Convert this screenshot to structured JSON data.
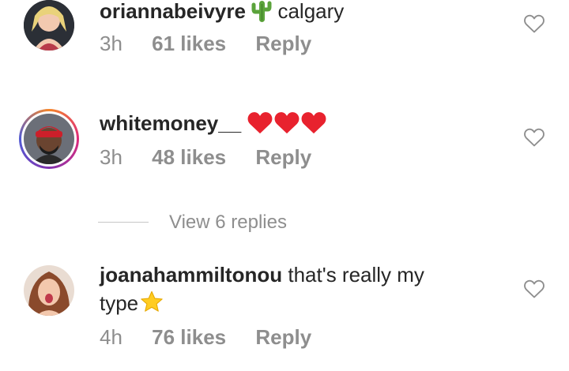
{
  "comments": [
    {
      "username": "oriannabeivyre",
      "text": "calgary",
      "time": "3h",
      "likes": "61 likes",
      "reply": "Reply",
      "emoji": "cactus-icon"
    },
    {
      "username": "whitemoney__",
      "text": "",
      "time": "3h",
      "likes": "48 likes",
      "reply": "Reply",
      "emoji": "three-red-hearts"
    },
    {
      "username": "joanahammiltonou",
      "text": "that's really my",
      "text_line2": "type",
      "time": "4h",
      "likes": "76 likes",
      "reply": "Reply",
      "emoji": "star-icon"
    }
  ],
  "view_replies": "View 6 replies",
  "colors": {
    "text": "#262626",
    "muted": "#8e8e8e",
    "heart_red": "#e8222e",
    "star": "#ffcc22",
    "cactus": "#5ba33b"
  }
}
